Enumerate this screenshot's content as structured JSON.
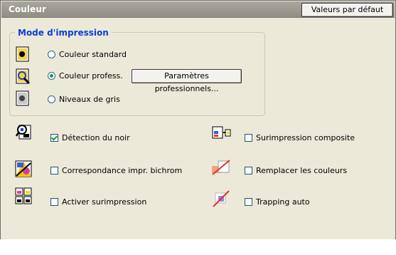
{
  "window": {
    "title": "Couleur",
    "defaults_button": "Valeurs par défaut"
  },
  "print_mode": {
    "group_title": "Mode d'impression",
    "options": [
      {
        "label": "Couleur standard",
        "selected": false,
        "icon": "standard-color-icon"
      },
      {
        "label": "Couleur profess.",
        "selected": true,
        "icon": "professional-color-icon"
      },
      {
        "label": "Niveaux de gris",
        "selected": false,
        "icon": "grayscale-icon"
      }
    ],
    "pro_settings_button": "Paramètres professionnels..."
  },
  "options_left": [
    {
      "label": "Détection du noir",
      "checked": true,
      "icon": "black-detection-icon"
    },
    {
      "label": "Correspondance impr. bichrom",
      "checked": false,
      "icon": "two-color-match-icon"
    },
    {
      "label": "Activer surimpression",
      "checked": false,
      "icon": "overprint-icon"
    }
  ],
  "options_right": [
    {
      "label": "Surimpression composite",
      "checked": false,
      "icon": "composite-overprint-icon"
    },
    {
      "label": "Remplacer les couleurs",
      "checked": false,
      "icon": "substitute-colors-icon"
    },
    {
      "label": "Trapping auto",
      "checked": false,
      "icon": "auto-trapping-icon"
    }
  ],
  "colors": {
    "group_title": "#0b3fd6",
    "radio_selected": "#1e9b2a",
    "check": "#21a121",
    "titlebar": "#9b998f"
  }
}
